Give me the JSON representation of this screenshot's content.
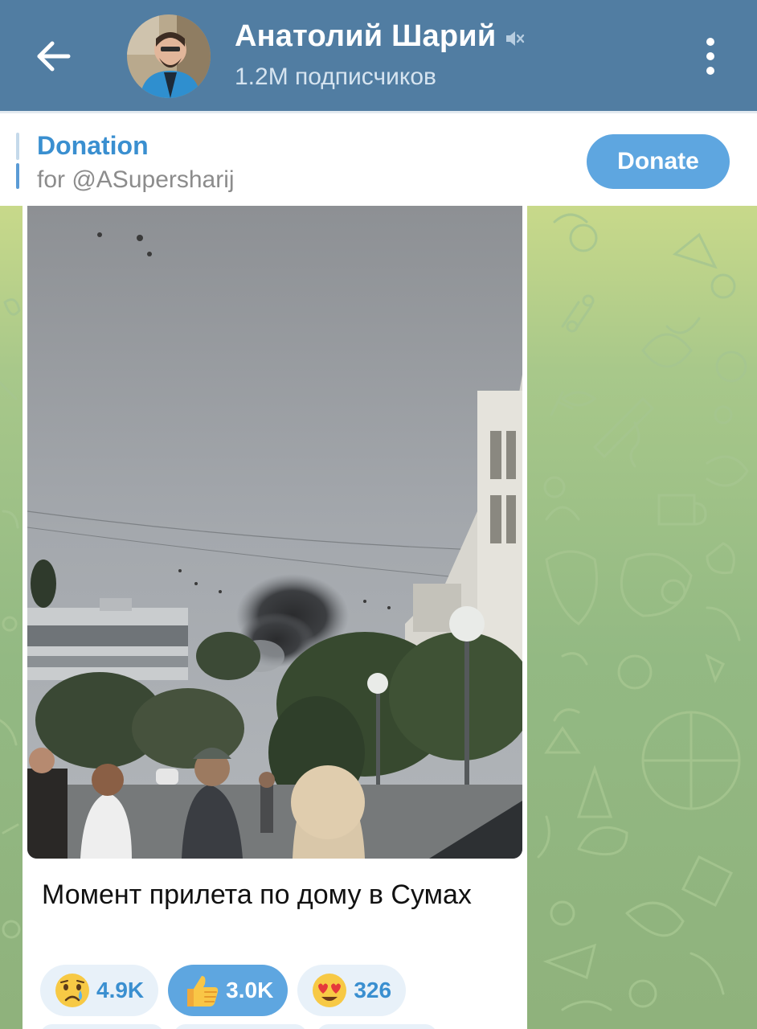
{
  "header": {
    "title": "Анатолий Шарий",
    "subscribers": "1.2M подписчиков",
    "back_icon": "arrow-left-icon",
    "mute_icon": "muted-speaker-icon",
    "menu_icon": "more-vertical-icon",
    "background_color": "#517da2"
  },
  "pinned": {
    "title": "Donation",
    "subtitle": "for @ASupersharij",
    "button_label": "Donate",
    "accent_color": "#3a8fd0"
  },
  "message": {
    "caption": "Момент прилета по дому в Сумах",
    "media_type": "video",
    "reactions": [
      {
        "emoji": "crying-face",
        "count": "4.9K",
        "active": false
      },
      {
        "emoji": "thumbs-up",
        "count": "3.0K",
        "active": true
      },
      {
        "emoji": "heart-eyes-face",
        "count": "326",
        "active": false
      }
    ]
  }
}
